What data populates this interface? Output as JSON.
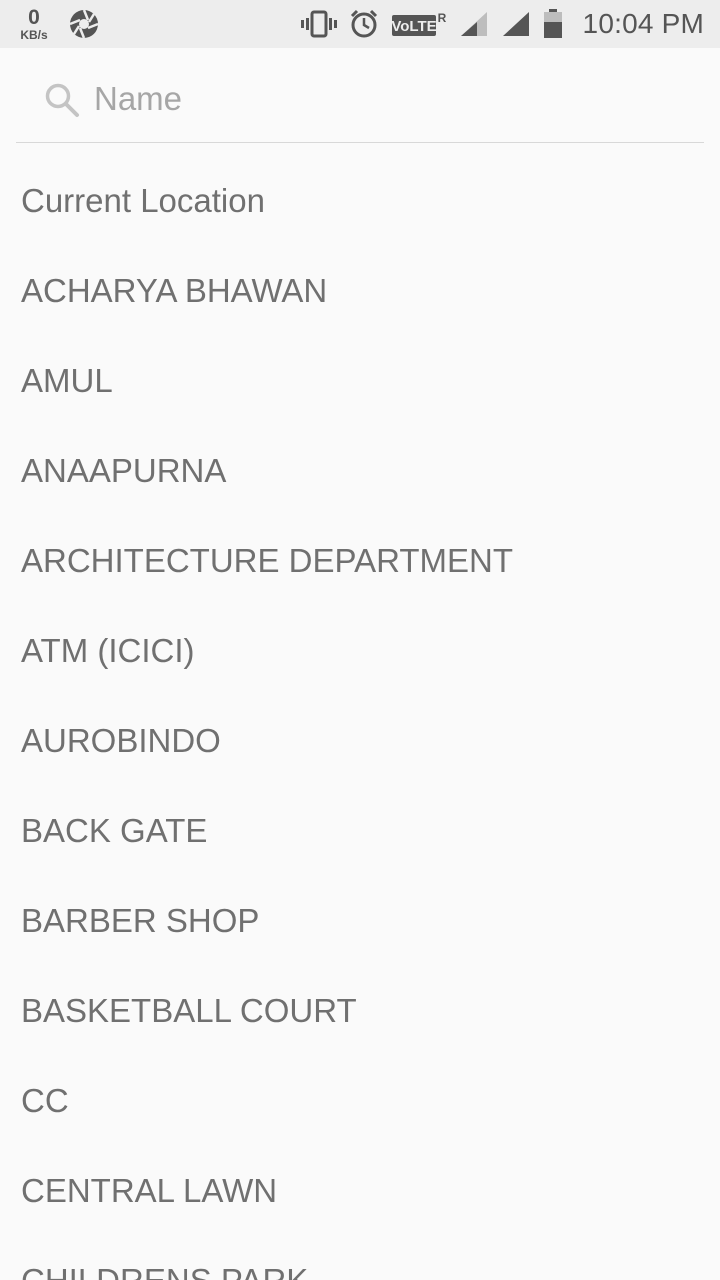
{
  "status_bar": {
    "net_speed_value": "0",
    "net_speed_unit": "KB/s",
    "volte_label": "VoLTE",
    "roaming_label": "R",
    "time": "10:04 PM",
    "icons": [
      "aperture-icon",
      "vibrate-icon",
      "alarm-icon",
      "volte-icon",
      "signal-icon",
      "signal-icon",
      "battery-icon"
    ]
  },
  "search": {
    "placeholder": "Name",
    "value": "",
    "icon": "search-icon"
  },
  "locations": [
    "Current Location",
    "ACHARYA BHAWAN",
    "AMUL",
    "ANAAPURNA",
    "ARCHITECTURE DEPARTMENT",
    "ATM (ICICI)",
    "AUROBINDO",
    "BACK GATE",
    "BARBER SHOP",
    "BASKETBALL COURT",
    "CC",
    "CENTRAL LAWN",
    "CHILDRENS PARK"
  ],
  "colors": {
    "background": "#fafafa",
    "status_bar": "#ededed",
    "item_text": "#707070",
    "placeholder": "#a6a6a6",
    "divider": "#d8d8d8"
  }
}
